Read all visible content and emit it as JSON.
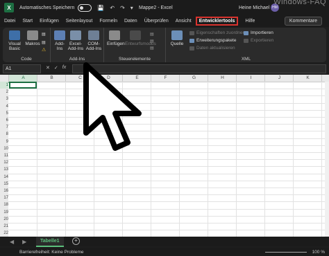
{
  "titlebar": {
    "app_letter": "X",
    "autosave_label": "Automatisches Speichern",
    "doc_title": "Mappe2  -  Excel",
    "user_name": "Heine Michael",
    "avatar_initials": "HM",
    "watermark": "Windows-FAQ"
  },
  "tabs": [
    "Datei",
    "Start",
    "Einfügen",
    "Seitenlayout",
    "Formeln",
    "Daten",
    "Überprüfen",
    "Ansicht"
  ],
  "active_tab": "Entwicklertools",
  "tab_after": "Hilfe",
  "comments_button": "Kommentare",
  "ribbon": {
    "code": {
      "label": "Code",
      "visual_basic": "Visual Basic",
      "makros": "Makros"
    },
    "addins": {
      "label": "Add-Ins",
      "addins": "Add-Ins",
      "excel_addins": "Excel-Add-Ins",
      "com_addins": "COM-Add-Ins"
    },
    "controls": {
      "label": "Steuerelemente",
      "insert": "Einfügen",
      "design_mode": "Entwurfsmodus"
    },
    "xml": {
      "label": "XML",
      "source": "Quelle",
      "map_props": "Eigenschaften zuordnen",
      "expansion": "Erweiterungspakete",
      "refresh": "Daten aktualisieren",
      "import": "Importieren",
      "export": "Exportieren"
    }
  },
  "formula_bar": {
    "name_box": "A1",
    "fx": "fx"
  },
  "columns": [
    "A",
    "B",
    "C",
    "D",
    "E",
    "F",
    "G",
    "H",
    "I",
    "J",
    "K",
    "L"
  ],
  "rows": [
    "1",
    "2",
    "3",
    "4",
    "5",
    "6",
    "7",
    "8",
    "9",
    "10",
    "11",
    "12",
    "13",
    "14",
    "15",
    "16",
    "17",
    "18",
    "19",
    "20",
    "21",
    "22"
  ],
  "sheet_tab": "Tabelle1",
  "status": {
    "accessibility": "Barrierefreiheit: Keine Probleme",
    "zoom": "100 %"
  },
  "colors": {
    "accent_green": "#1d6f42",
    "highlight_red": "#d9332e"
  }
}
